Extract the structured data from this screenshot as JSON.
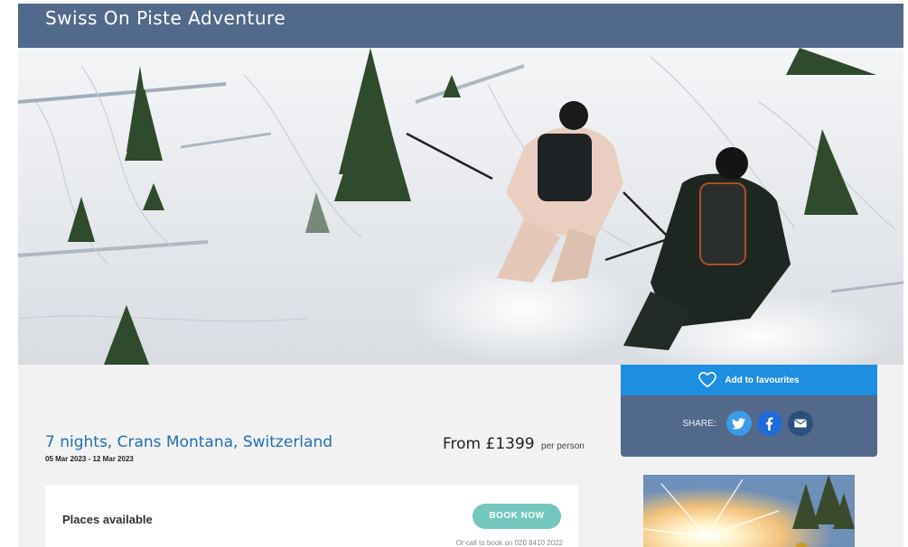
{
  "header": {
    "title": "Swiss On Piste Adventure"
  },
  "hero": {
    "alt": "Two skiers descending a snowy slope between pine trees"
  },
  "trip": {
    "title": "7 nights, Crans Montana, Switzerland",
    "dates": "05 Mar 2023 - 12 Mar 2023",
    "price_prefix": "From £1399",
    "price_suffix": "per person"
  },
  "booking": {
    "places_label": "Places available",
    "book_label": "BOOK NOW",
    "call_text": "Or call to book on 020 8410 2022"
  },
  "sidebar": {
    "favourite_label": "Add to favourites",
    "share_label": "SHARE:",
    "social": [
      "twitter-icon",
      "facebook-icon",
      "email-icon"
    ]
  },
  "colors": {
    "header": "#53698a",
    "accent_blue": "#1d8ee0",
    "title_blue": "#1f6fb5",
    "book_button": "#74c7bd"
  }
}
